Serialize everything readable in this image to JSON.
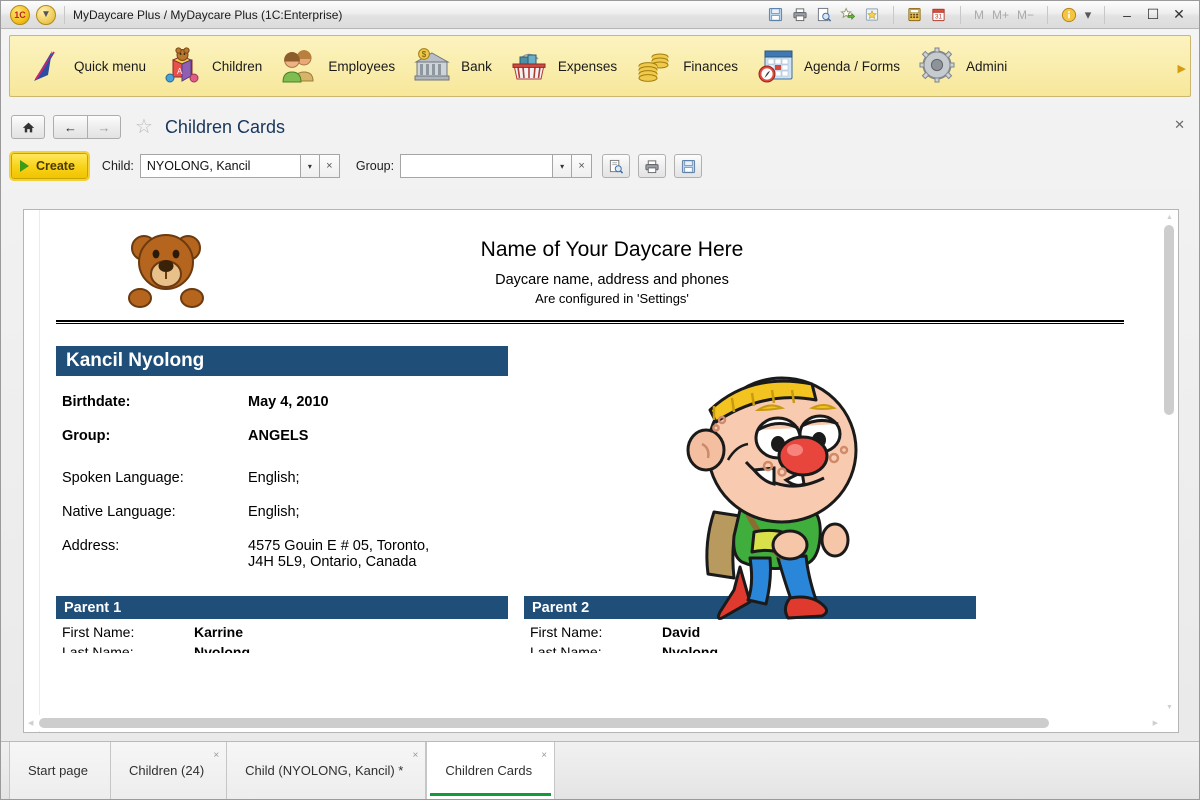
{
  "window": {
    "title": "MyDaycare Plus / MyDaycare Plus  (1C:Enterprise)",
    "orb_main": "1C",
    "orb_menu": "▼",
    "toolbar_icons": [
      {
        "name": "save-icon",
        "glyph": "💾"
      },
      {
        "name": "print-icon",
        "glyph": "🖨"
      },
      {
        "name": "print-preview-icon",
        "glyph": "🔍"
      },
      {
        "name": "favorites-add-icon",
        "glyph": "☆"
      },
      {
        "name": "favorites-icon",
        "glyph": "☆"
      },
      {
        "name": "calculator-icon",
        "glyph": "🗒"
      },
      {
        "name": "calendar-icon",
        "glyph": "31"
      }
    ],
    "memory": {
      "m": "M",
      "m_plus": "M+",
      "m_minus": "M−"
    },
    "info": "i",
    "info_caret": "▾",
    "minimize": "–",
    "maximize": "☐",
    "close": "✕"
  },
  "nav": {
    "items": [
      {
        "label": "Quick menu",
        "icon": "quick-menu-icon"
      },
      {
        "label": "Children",
        "icon": "children-toybox-icon"
      },
      {
        "label": "Employees",
        "icon": "employees-people-icon"
      },
      {
        "label": "Bank",
        "icon": "bank-building-icon"
      },
      {
        "label": "Expenses",
        "icon": "expenses-basket-icon"
      },
      {
        "label": "Finances",
        "icon": "finances-coins-icon"
      },
      {
        "label": "Agenda / Forms",
        "icon": "agenda-calendar-icon"
      },
      {
        "label": "Admini",
        "icon": "administration-gear-icon"
      }
    ],
    "more_arrow": "▶"
  },
  "pagebar": {
    "home": "⌂",
    "back": "←",
    "forward": "→",
    "favorite_star": "☆",
    "title": "Children Cards",
    "close": "✕"
  },
  "commandbar": {
    "create_label": "Create",
    "child_label": "Child:",
    "child_value": "NYOLONG, Kancil",
    "child_placeholder": "",
    "group_label": "Group:",
    "group_value": "",
    "group_placeholder": "",
    "dropdown_glyph": "▾",
    "clear_glyph": "×",
    "tools": [
      {
        "name": "preview-button",
        "glyph": "🔎"
      },
      {
        "name": "print-button",
        "glyph": "🖨"
      },
      {
        "name": "save-button",
        "glyph": "💾"
      }
    ]
  },
  "document": {
    "header": {
      "title": "Name of Your Daycare Here",
      "line2": "Daycare name, address and phones",
      "line3": "Are configured in 'Settings'"
    },
    "child_name": "Kancil Nyolong",
    "fields": [
      {
        "label": "Birthdate:",
        "value": "May 4, 2010",
        "bold": true
      },
      {
        "label": "Group:",
        "value": "ANGELS",
        "bold": true
      },
      {
        "label": "Spoken Language:",
        "value": "English;",
        "bold": false
      },
      {
        "label": "Native Language:",
        "value": "English;",
        "bold": false
      },
      {
        "label": "Address:",
        "value": "4575 Gouin E # 05, Toronto,",
        "bold": false
      }
    ],
    "address_line2": "J4H 5L9, Ontario, Canada",
    "parents": [
      {
        "heading": "Parent 1",
        "first_name_label": "First Name:",
        "first_name": "Karrine",
        "last_name_label": "Last Name:",
        "last_name": "Nyolong"
      },
      {
        "heading": "Parent 2",
        "first_name_label": "First Name:",
        "first_name": "David",
        "last_name_label": "Last Name:",
        "last_name": "Nyolong"
      }
    ]
  },
  "tabs": [
    {
      "label": "Start page",
      "closable": false,
      "active": false
    },
    {
      "label": "Children (24)",
      "closable": true,
      "active": false
    },
    {
      "label": "Child (NYOLONG, Kancil) *",
      "closable": true,
      "active": false
    },
    {
      "label": "Children Cards",
      "closable": true,
      "active": true
    }
  ],
  "tab_close_glyph": "×",
  "colors": {
    "nav_yellow": "#f9eda8",
    "banner_navy": "#1f4e79",
    "create_yellow": "#f9d21a",
    "active_tab_underline": "#149a3e",
    "title_blue": "#17365d"
  }
}
